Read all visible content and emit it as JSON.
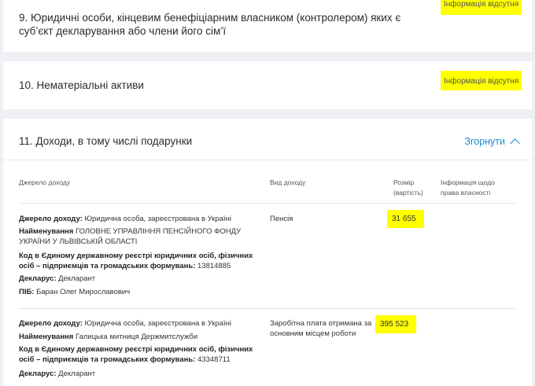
{
  "section9": {
    "title": "9. Юридичні особи, кінцевим бенефіціарним власником (контролером) яких є суб’єкт декларування або члени його сім’ї",
    "status": "Інформація відсутня"
  },
  "section10": {
    "title": "10. Нематеріальні активи",
    "status": "Інформація відсутня"
  },
  "section11": {
    "title": "11. Доходи, в тому числі подарунки",
    "collapse_label": "Згорнути",
    "columns": {
      "source": "Джерело доходу",
      "type": "Вид доходу",
      "amount": "Розмір (вартість)",
      "ownership": "Інформація щодо права власності"
    },
    "rows": [
      {
        "source_label": "Джерело доходу:",
        "source_value": "Юридична особа, зареєстрована в Україні",
        "name_label": "Найменування",
        "name_value": "ГОЛОВНЕ УПРАВЛІННЯ ПЕНСІЙНОГО ФОНДУ УКРАЇНИ У ЛЬВІВСЬКІЙ ОБЛАСТІ",
        "code_label": "Код в Єдиному державному реєстрі юридичних осіб, фізичних осіб – підприємців та громадських формувань:",
        "code_value": "13814885",
        "declarant_label": "Декларус:",
        "declarant_value": "Декларант",
        "pib_label": "ПІБ:",
        "pib_value": "Баран Олег Мирославович",
        "type": "Пенсія",
        "amount": "31 655"
      },
      {
        "source_label": "Джерело доходу:",
        "source_value": "Юридична особа, зареєстрована в Україні",
        "name_label": "Найменування",
        "name_value": "Галицька митниця Держмитслужби",
        "code_label": "Код в Єдиному державному реєстрі юридичних осіб, фізичних осіб – підприємців та громадських формувань:",
        "code_value": "43348711",
        "declarant_label": "Декларус:",
        "declarant_value": "Декларант",
        "type": "Заробітна плата отримана за основним місцем роботи",
        "amount": "395 523"
      }
    ]
  },
  "colors": {
    "highlight": "#ffff00",
    "link": "#1e88c8",
    "background": "#eef0f3"
  }
}
